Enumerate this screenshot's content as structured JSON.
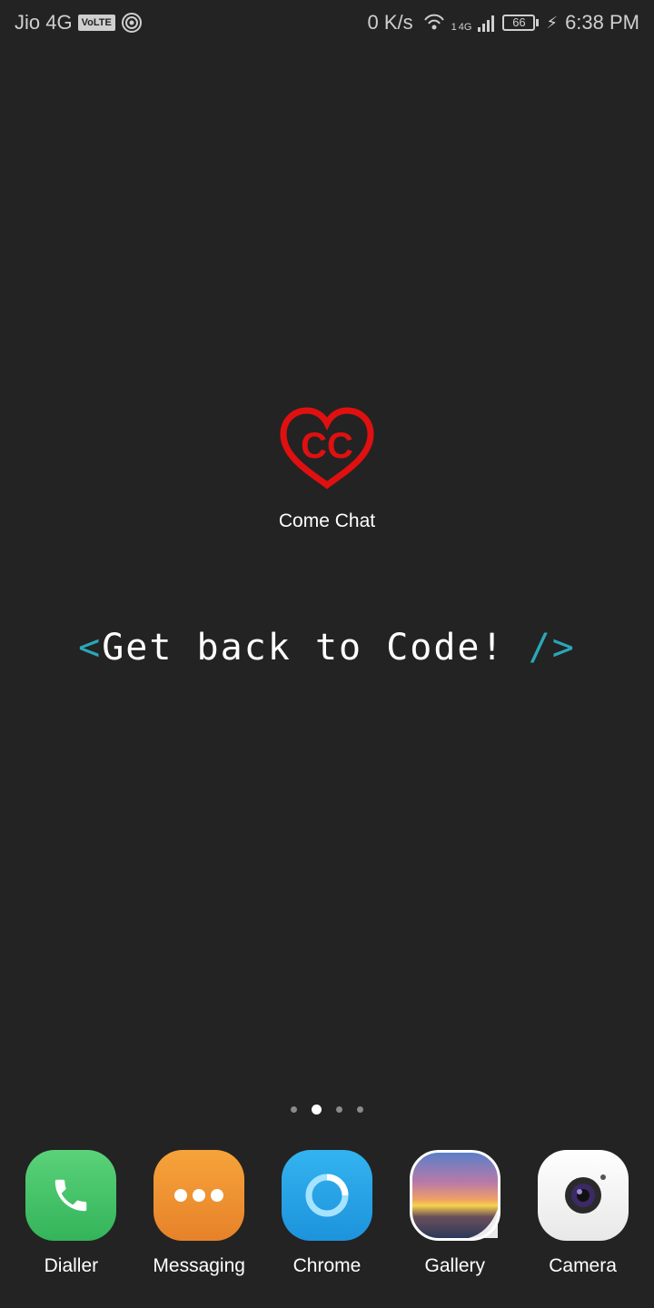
{
  "status_bar": {
    "carrier": "Jio 4G",
    "volte": "VoLTE",
    "net_speed": "0 K/s",
    "network_sup": "1",
    "network_type": "4G",
    "battery_level": "66",
    "time": "6:38 PM"
  },
  "home": {
    "shortcut": {
      "label": "Come Chat",
      "logo_text": "CC",
      "logo_color": "#e01010"
    },
    "tagline": {
      "open_bracket": "<",
      "text": "Get back to Code!",
      "close_bracket": "/>",
      "bracket_color": "#2aa7b8"
    },
    "pages": {
      "count": 4,
      "active_index": 1
    }
  },
  "dock": {
    "items": [
      {
        "label": "Dialler",
        "icon": "phone-icon",
        "color": "#3fbf63"
      },
      {
        "label": "Messaging",
        "icon": "messaging-icon",
        "color": "#f0932f"
      },
      {
        "label": "Chrome",
        "icon": "chrome-icon",
        "color": "#24a2e6"
      },
      {
        "label": "Gallery",
        "icon": "gallery-icon",
        "color": "#f0a065"
      },
      {
        "label": "Camera",
        "icon": "camera-icon",
        "color": "#ffffff"
      }
    ]
  }
}
